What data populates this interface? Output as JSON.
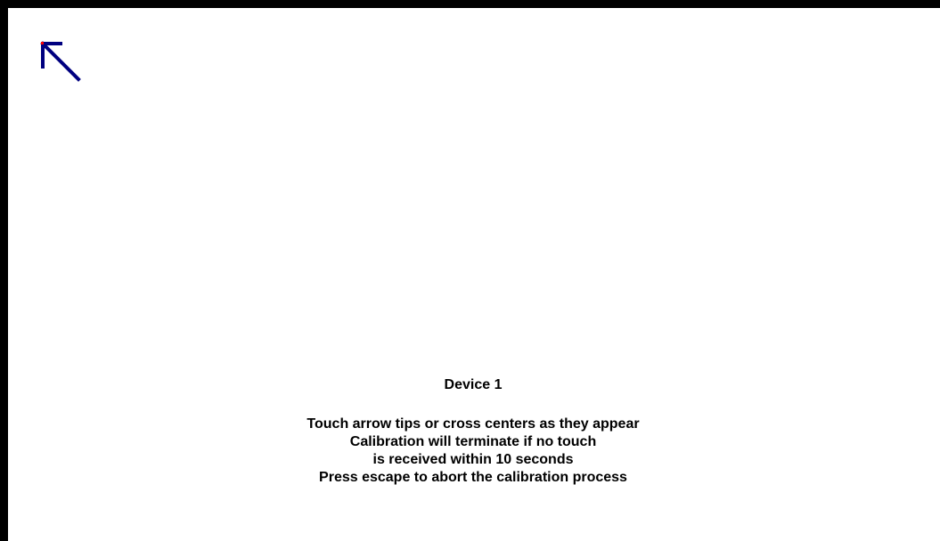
{
  "screen": {
    "background_color": "#000000",
    "panel_color": "#ffffff"
  },
  "target": {
    "icon": "arrow-up-left-icon",
    "arrow_color": "#000080",
    "tip_color": "#ff0000"
  },
  "instructions": {
    "device_label": "Device 1",
    "lines": [
      "Touch arrow tips or cross centers as they appear",
      "Calibration will terminate if no touch",
      "is received within 10 seconds",
      "Press escape to abort the calibration process"
    ]
  }
}
